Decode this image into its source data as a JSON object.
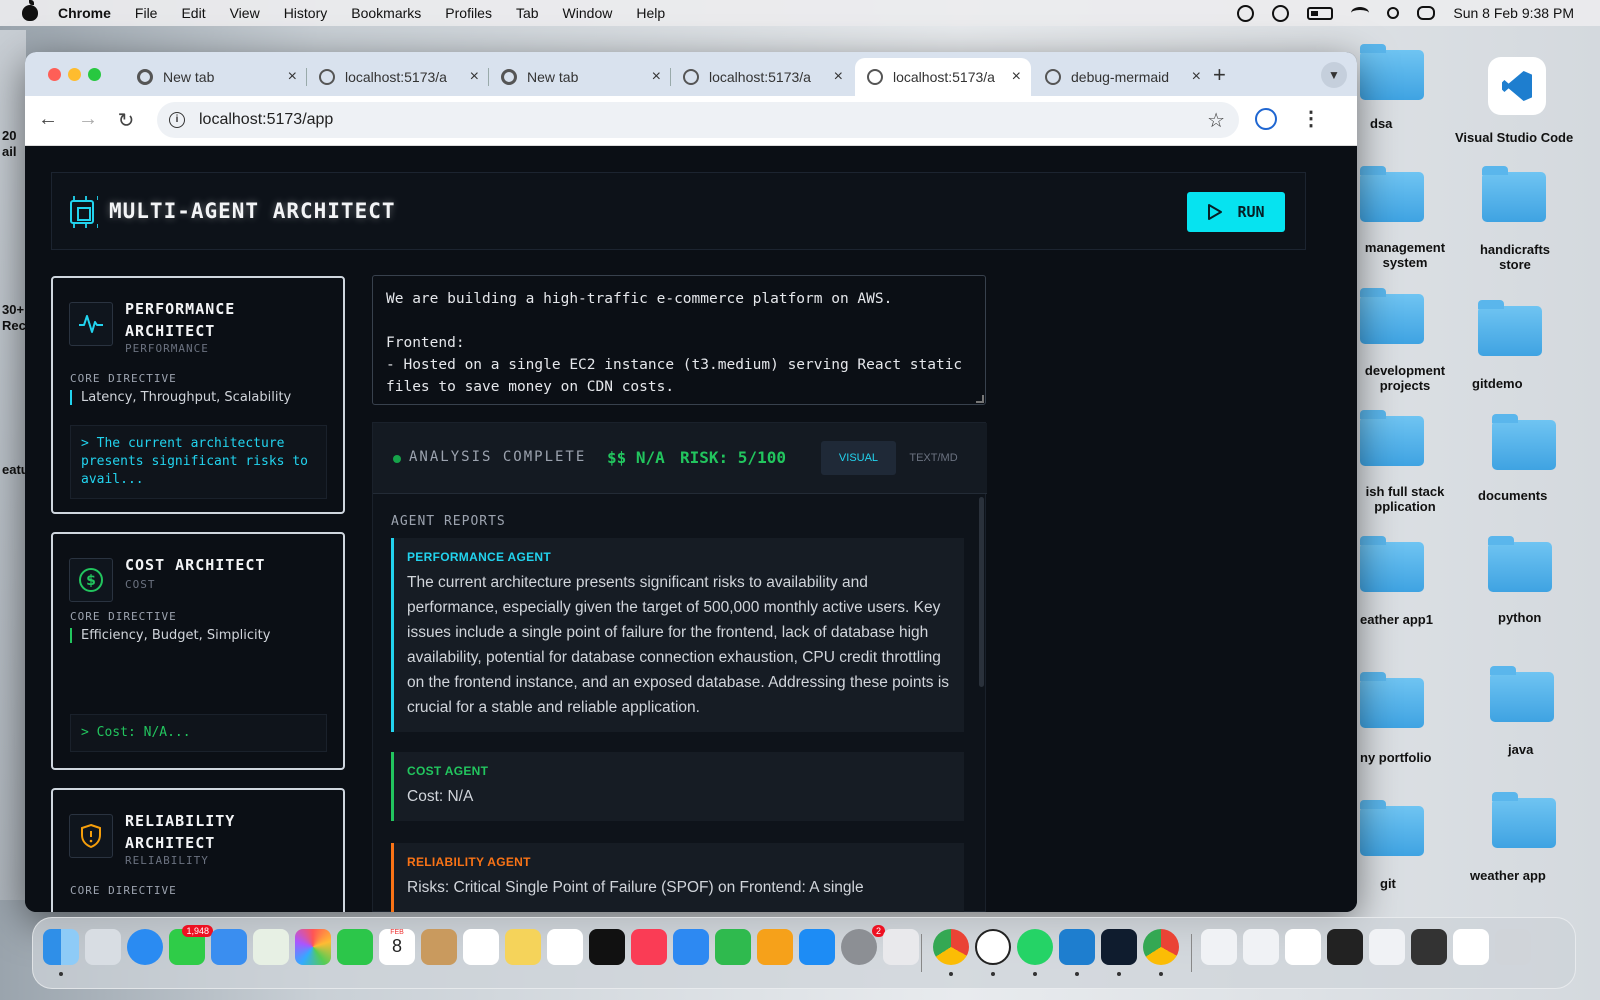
{
  "menubar": {
    "app": "Chrome",
    "items": [
      "File",
      "Edit",
      "View",
      "History",
      "Bookmarks",
      "Profiles",
      "Tab",
      "Window",
      "Help"
    ],
    "date_time": "Sun 8 Feb  9:38 PM"
  },
  "browser": {
    "tabs": [
      {
        "title": "New tab",
        "active": false
      },
      {
        "title": "localhost:5173/a",
        "active": false
      },
      {
        "title": "New tab",
        "active": false
      },
      {
        "title": "localhost:5173/a",
        "active": false
      },
      {
        "title": "localhost:5173/a",
        "active": true
      },
      {
        "title": "debug-mermaid",
        "active": false
      }
    ],
    "url": "localhost:5173/app"
  },
  "app": {
    "title": "MULTI-AGENT ARCHITECT",
    "run_label": "RUN",
    "input_text": "We are building a high-traffic e-commerce platform on AWS.\n\nFrontend:\n- Hosted on a single EC2 instance (t3.medium) serving React static files to save money on CDN costs.",
    "agents": [
      {
        "name": "PERFORMANCE ARCHITECT",
        "sub": "PERFORMANCE",
        "directive_label": "CORE DIRECTIVE",
        "directive": "Latency, Throughput, Scalability",
        "output": "> The current architecture presents significant risks to avail...",
        "accent": "#22d3ee",
        "icon": "activity-pulse-icon"
      },
      {
        "name": "COST ARCHITECT",
        "sub": "COST",
        "directive_label": "CORE DIRECTIVE",
        "directive": "Efficiency, Budget, Simplicity",
        "output": "> Cost: N/A...",
        "accent": "#22c55e",
        "icon": "dollar-circle-icon"
      },
      {
        "name": "RELIABILITY ARCHITECT",
        "sub": "RELIABILITY",
        "directive_label": "CORE DIRECTIVE",
        "accent": "#f59e0b",
        "icon": "shield-alert-icon"
      }
    ],
    "status": {
      "label": "ANALYSIS COMPLETE",
      "cost": "$$ N/A",
      "risk": "RISK: 5/100",
      "view_visual": "VISUAL",
      "view_text": "TEXT/MD"
    },
    "reports": {
      "title": "AGENT REPORTS",
      "items": [
        {
          "label": "PERFORMANCE AGENT",
          "color": "#22d3ee",
          "text": "The current architecture presents significant risks to availability and performance, especially given the target of 500,000 monthly active users. Key issues include a single point of failure for the frontend, lack of database high availability, potential for database connection exhaustion, CPU credit throttling on the frontend instance, and an exposed database. Addressing these points is crucial for a stable and reliable application."
        },
        {
          "label": "COST AGENT",
          "color": "#22c55e",
          "text": "Cost: N/A"
        },
        {
          "label": "RELIABILITY AGENT",
          "color": "#f97316",
          "text": "Risks: Critical Single Point of Failure (SPOF) on Frontend: A single"
        }
      ]
    }
  },
  "desktop": {
    "left_labels": [
      "20",
      "ail",
      "30+",
      "Rec",
      "eatu"
    ],
    "icons": [
      {
        "label": "dsa"
      },
      {
        "label": "Visual Studio Code"
      },
      {
        "label": "management system"
      },
      {
        "label": "handicrafts store"
      },
      {
        "label": "development projects"
      },
      {
        "label": "gitdemo"
      },
      {
        "label": "ish full stack pplication"
      },
      {
        "label": "documents"
      },
      {
        "label": "eather app1"
      },
      {
        "label": "python"
      },
      {
        "label": "ny portfolio"
      },
      {
        "label": "java"
      },
      {
        "label": "git"
      },
      {
        "label": "weather app"
      }
    ]
  },
  "dock": {
    "badge_messages": "1,948",
    "badge_settings": "2",
    "calendar_month": "FEB",
    "calendar_day": "8"
  }
}
